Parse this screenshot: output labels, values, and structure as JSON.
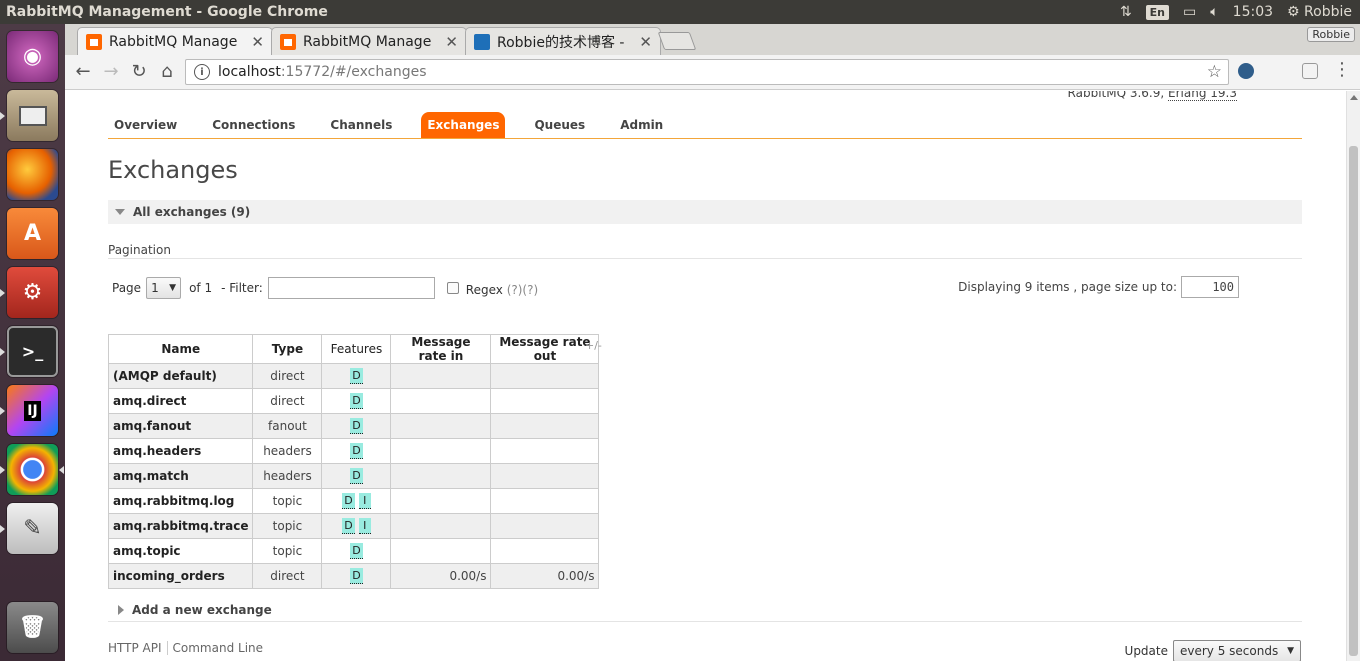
{
  "os": {
    "window_title": "RabbitMQ Management - Google Chrome",
    "keyboard_layout": "En",
    "clock": "15:03",
    "user": "Robbie"
  },
  "browser": {
    "tabs": [
      {
        "label": "RabbitMQ Manage",
        "active": true
      },
      {
        "label": "RabbitMQ Manage",
        "active": false
      },
      {
        "label": "Robbie的技术博客 -",
        "active": false
      }
    ],
    "profile": "Robbie",
    "url_host": "localhost",
    "url_rest": ":15772/#/exchanges"
  },
  "page": {
    "version_prefix": "RabbitMQ 3.6.9,",
    "version_erlang": "Erlang 19.3",
    "nav": [
      "Overview",
      "Connections",
      "Channels",
      "Exchanges",
      "Queues",
      "Admin"
    ],
    "active_nav": "Exchanges",
    "title": "Exchanges",
    "section_label": "All exchanges (9)",
    "pagination_label": "Pagination",
    "page_label": "Page",
    "page_value": "1",
    "of_label": "of 1",
    "filter_label": "- Filter:",
    "regex_label": "Regex",
    "regex_help": "(?)(?)",
    "displaying_label": "Displaying 9 items , page size up to:",
    "page_size": "100",
    "columns": [
      "Name",
      "Type",
      "Features",
      "Message rate in",
      "Message rate out"
    ],
    "column_toggle": "+/-",
    "add_label": "Add a new exchange",
    "footer_http": "HTTP API",
    "footer_cli": "Command Line",
    "update_label": "Update",
    "update_value": "every 5 seconds"
  },
  "exchanges": [
    {
      "name": "(AMQP default)",
      "type": "direct",
      "features": [
        "D"
      ],
      "rate_in": "",
      "rate_out": ""
    },
    {
      "name": "amq.direct",
      "type": "direct",
      "features": [
        "D"
      ],
      "rate_in": "",
      "rate_out": ""
    },
    {
      "name": "amq.fanout",
      "type": "fanout",
      "features": [
        "D"
      ],
      "rate_in": "",
      "rate_out": ""
    },
    {
      "name": "amq.headers",
      "type": "headers",
      "features": [
        "D"
      ],
      "rate_in": "",
      "rate_out": ""
    },
    {
      "name": "amq.match",
      "type": "headers",
      "features": [
        "D"
      ],
      "rate_in": "",
      "rate_out": ""
    },
    {
      "name": "amq.rabbitmq.log",
      "type": "topic",
      "features": [
        "D",
        "I"
      ],
      "rate_in": "",
      "rate_out": ""
    },
    {
      "name": "amq.rabbitmq.trace",
      "type": "topic",
      "features": [
        "D",
        "I"
      ],
      "rate_in": "",
      "rate_out": ""
    },
    {
      "name": "amq.topic",
      "type": "topic",
      "features": [
        "D"
      ],
      "rate_in": "",
      "rate_out": ""
    },
    {
      "name": "incoming_orders",
      "type": "direct",
      "features": [
        "D"
      ],
      "rate_in": "0.00/s",
      "rate_out": "0.00/s"
    }
  ],
  "colors": {
    "accent": "#ff6600",
    "feature_badge": "#99ebe0",
    "launcher": "#4d3b46"
  },
  "launcher_icons": [
    "ubuntu-dash-icon",
    "file-cabinet-icon",
    "firefox-icon",
    "software-center-icon",
    "system-settings-icon",
    "terminal-icon",
    "intellij-icon",
    "chrome-icon",
    "text-editor-icon",
    "trash-icon"
  ]
}
